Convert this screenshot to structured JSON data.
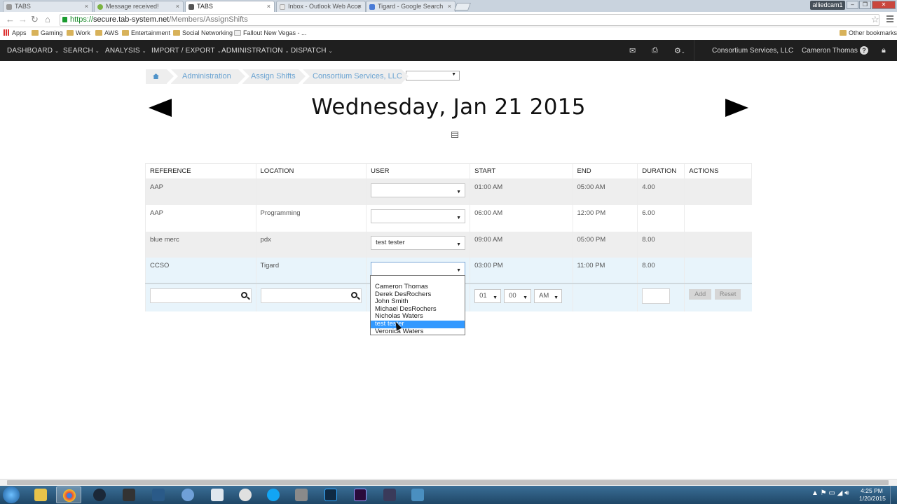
{
  "browser": {
    "tabs": [
      {
        "title": "TABS"
      },
      {
        "title": "Message received!"
      },
      {
        "title": "TABS"
      },
      {
        "title": "Inbox - Outlook Web Acce"
      },
      {
        "title": "Tigard - Google Search"
      }
    ],
    "user": "alliedcam1",
    "url_scheme": "https://",
    "url_host": "secure.tab-system.net",
    "url_path": "/Members/AssignShifts",
    "bookmarks": [
      "Apps",
      "Gaming",
      "Work",
      "AWS",
      "Entertainment",
      "Social Networking",
      "Fallout New Vegas - ..."
    ],
    "other_bookmarks": "Other bookmarks"
  },
  "nav": {
    "items": [
      "DASHBOARD",
      "SEARCH",
      "ANALYSIS",
      "IMPORT / EXPORT",
      "ADMINISTRATION",
      "DISPATCH"
    ],
    "company": "Consortium Services, LLC",
    "user": "Cameron Thomas"
  },
  "breadcrumb": [
    "Administration",
    "Assign Shifts",
    "Consortium Services, LLC"
  ],
  "page": {
    "date_title": "Wednesday, Jan 21 2015"
  },
  "table": {
    "headers": [
      "REFERENCE",
      "LOCATION",
      "USER",
      "START",
      "END",
      "DURATION",
      "ACTIONS"
    ],
    "rows": [
      {
        "reference": "AAP",
        "location": "",
        "user": "",
        "start": "01:00 AM",
        "end": "05:00 AM",
        "duration": "4.00"
      },
      {
        "reference": "AAP",
        "location": "Programming",
        "user": "",
        "start": "06:00 AM",
        "end": "12:00 PM",
        "duration": "6.00"
      },
      {
        "reference": "blue merc",
        "location": "pdx",
        "user": "test tester",
        "start": "09:00 AM",
        "end": "05:00 PM",
        "duration": "8.00"
      },
      {
        "reference": "CCSO",
        "location": "Tigard",
        "user": "",
        "start": "03:00 PM",
        "end": "11:00 PM",
        "duration": "8.00"
      }
    ],
    "new_row": {
      "hour": "01",
      "minute": "00",
      "ampm": "AM",
      "add_label": "Add",
      "reset_label": "Reset"
    }
  },
  "dropdown": {
    "options": [
      "Cameron Thomas",
      "Derek DesRochers",
      "John Smith",
      "Michael DesRochers",
      "Nicholas Waters",
      "test tester",
      "Veronica Waters"
    ],
    "highlighted": "test tester"
  },
  "taskbar": {
    "time": "4:25 PM",
    "date": "1/20/2015"
  },
  "colors": {
    "nav_bg": "#1f1f1f",
    "link": "#6aa3d1",
    "highlight": "#3399ff",
    "selected_row": "#e8f4fb"
  }
}
